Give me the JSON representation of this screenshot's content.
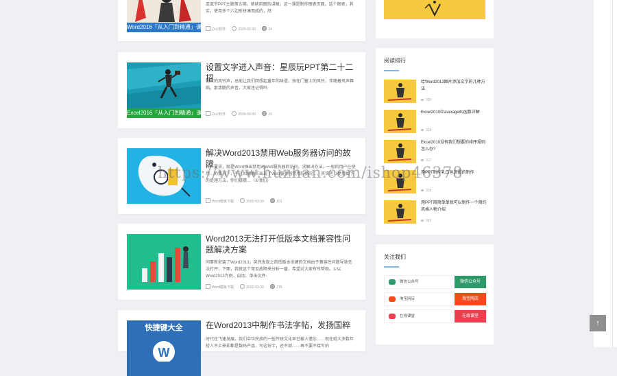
{
  "posts": [
    {
      "course_badge": "Word2016「从入门到精通」课程",
      "excerpt": "圣诞节PPT主题第五期，继续前面的讲解，这一课是制作图表页面。这个图表，其实，使用多个六边形拼凑而成的，然",
      "category": "办公软件",
      "date": "2020-03-30",
      "views": "34"
    },
    {
      "title": "设置文字进入声音：星辰玩PPT第二十二招",
      "course_badge": "Excel2016「从入门到精通」课程",
      "excerpt": "悦耳的风铃声，总能让我们回想起童年的味道，独在门窗上的风铃，伴随着风声舞蹈，那清脆的声音，大家还记得吗",
      "category": "办公软件",
      "date": "2020-03-30",
      "views": "16"
    },
    {
      "title": "解决Word2013禁用Web服务器访问的故障",
      "excerpt": "有人要求，就是Word弹出禁用对Web服务器的访问，求解决办法。一般的用户在使用…的情况下，不过如果确实出现了Web服务器禁用的情况…，其实可以使用如下的处理方法，你们猜猜…（①我们）",
      "category": "Word模板下载",
      "date": "2020-03-30",
      "views": "101"
    },
    {
      "title": "Word2013无法打开低版本文档兼容性问题解决方案",
      "excerpt": "同事新安装了Word2013，突然发现之前低版本创建的文档由于兼容性问题导致无法打开，下面，我就这个常见故障来分析一番，希望对大家有所帮助。①以Word2013为例，启动、单击文件-",
      "category": "Word模板下载",
      "date": "2020-03-30",
      "views": "276"
    },
    {
      "title": "在Word2013中制作书法字帖，发扬国粹",
      "thumb_text": "快捷键大全",
      "excerpt": "时代在飞速发展，我们中华民族的一些传统文化早已被人遗忘……现在绝大多数年轻人不上来却都是数码产品，写这份字，还不如……再不要不接写的"
    }
  ],
  "reading_rank": {
    "title": "阅读排行",
    "items": [
      {
        "title": "给Word2013图片添加文字的几种方法",
        "views": "320"
      },
      {
        "title": "Excel2010中averageifs函数详解",
        "views": "319"
      },
      {
        "title": "Excel2010没有我们想要的排序规则怎么办?",
        "views": "317"
      },
      {
        "title": "用PPT制作乳白色的圆的制作",
        "views": "316"
      },
      {
        "title": "用PPT简简单单就可以制作一个简约风格人物介绍",
        "views": "313"
      }
    ]
  },
  "follow_us": {
    "title": "关注我们",
    "rows": [
      {
        "label": "微信公众号",
        "button": "微信公众号",
        "color": "#2e9a6a"
      },
      {
        "label": "淘宝网店",
        "button": "淘宝网店",
        "color": "#f44b1a"
      },
      {
        "label": "在线课堂",
        "button": "在线课堂",
        "color": "#e8404f"
      }
    ]
  },
  "watermark": "https://www.huzhan.com/ishop46378",
  "back_to_top": "↑",
  "colors": {
    "accent_blue": "#7bb6e8",
    "thumb_yellow": "#f7c93e"
  }
}
